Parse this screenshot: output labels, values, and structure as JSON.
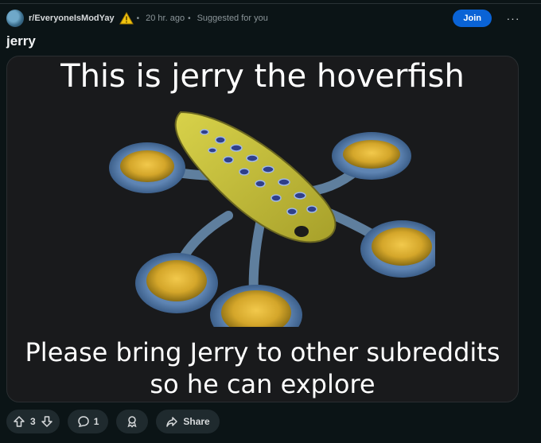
{
  "post": {
    "subreddit": "r/EveryoneIsModYay",
    "time": "20 hr. ago",
    "suggestion": "Suggested for you",
    "join_label": "Join",
    "more_label": "···",
    "title": "jerry"
  },
  "image": {
    "caption_top": "This is jerry the hoverfish",
    "caption_bottom_line1": "Please bring Jerry to other subreddits",
    "caption_bottom_line2": "so he can explore"
  },
  "actions": {
    "vote_count": "3",
    "comment_count": "1",
    "share_label": "Share"
  },
  "colors": {
    "background": "#0b1416",
    "join_button": "#0a63d6",
    "action_pill": "#1f2a2e"
  },
  "icons": [
    "subreddit-avatar",
    "warning-icon",
    "more-icon",
    "upvote-icon",
    "downvote-icon",
    "comment-icon",
    "award-icon",
    "share-icon"
  ]
}
